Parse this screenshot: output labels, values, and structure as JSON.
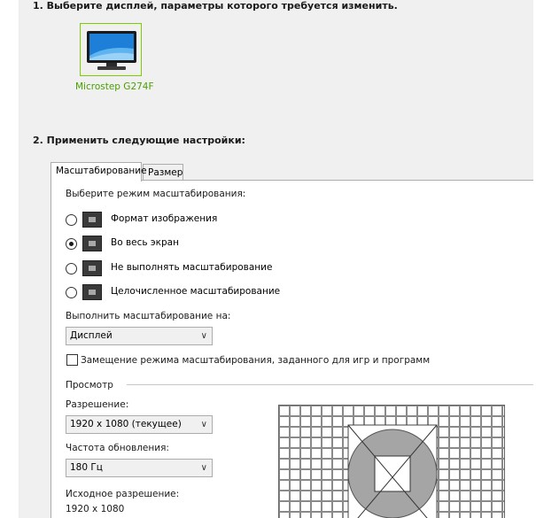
{
  "sections": {
    "select_display": "1. Выберите дисплей, параметры которого требуется изменить.",
    "apply_settings": "2. Применить следующие настройки:"
  },
  "display": {
    "name": "Microstep G274F",
    "icon": "monitor-icon"
  },
  "tabs": [
    {
      "label": "Масштабирование"
    },
    {
      "label": "Размер"
    }
  ],
  "scaling": {
    "mode_label": "Выберите режим масштабирования:",
    "options": [
      {
        "label": "Формат изображения",
        "selected": false,
        "icon": "aspect-ratio-icon"
      },
      {
        "label": "Во весь экран",
        "selected": true,
        "icon": "fullscreen-icon"
      },
      {
        "label": "Не выполнять масштабирование",
        "selected": false,
        "icon": "no-scaling-icon"
      },
      {
        "label": "Целочисленное масштабирование",
        "selected": false,
        "icon": "integer-scaling-icon"
      }
    ],
    "perform_on_label": "Выполнить масштабирование на:",
    "perform_on_value": "Дисплей",
    "override_label": "Замещение режима масштабирования, заданного для игр и программ",
    "override_checked": false
  },
  "preview": {
    "group_label": "Просмотр",
    "resolution_label": "Разрешение:",
    "resolution_value": "1920 x 1080 (текущее)",
    "refresh_label": "Частота обновления:",
    "refresh_value": "180 Гц",
    "native_label": "Исходное разрешение:",
    "native_value": "1920 x 1080"
  },
  "colors": {
    "accent_green": "#76b900",
    "display_name_green": "#4aa000"
  }
}
